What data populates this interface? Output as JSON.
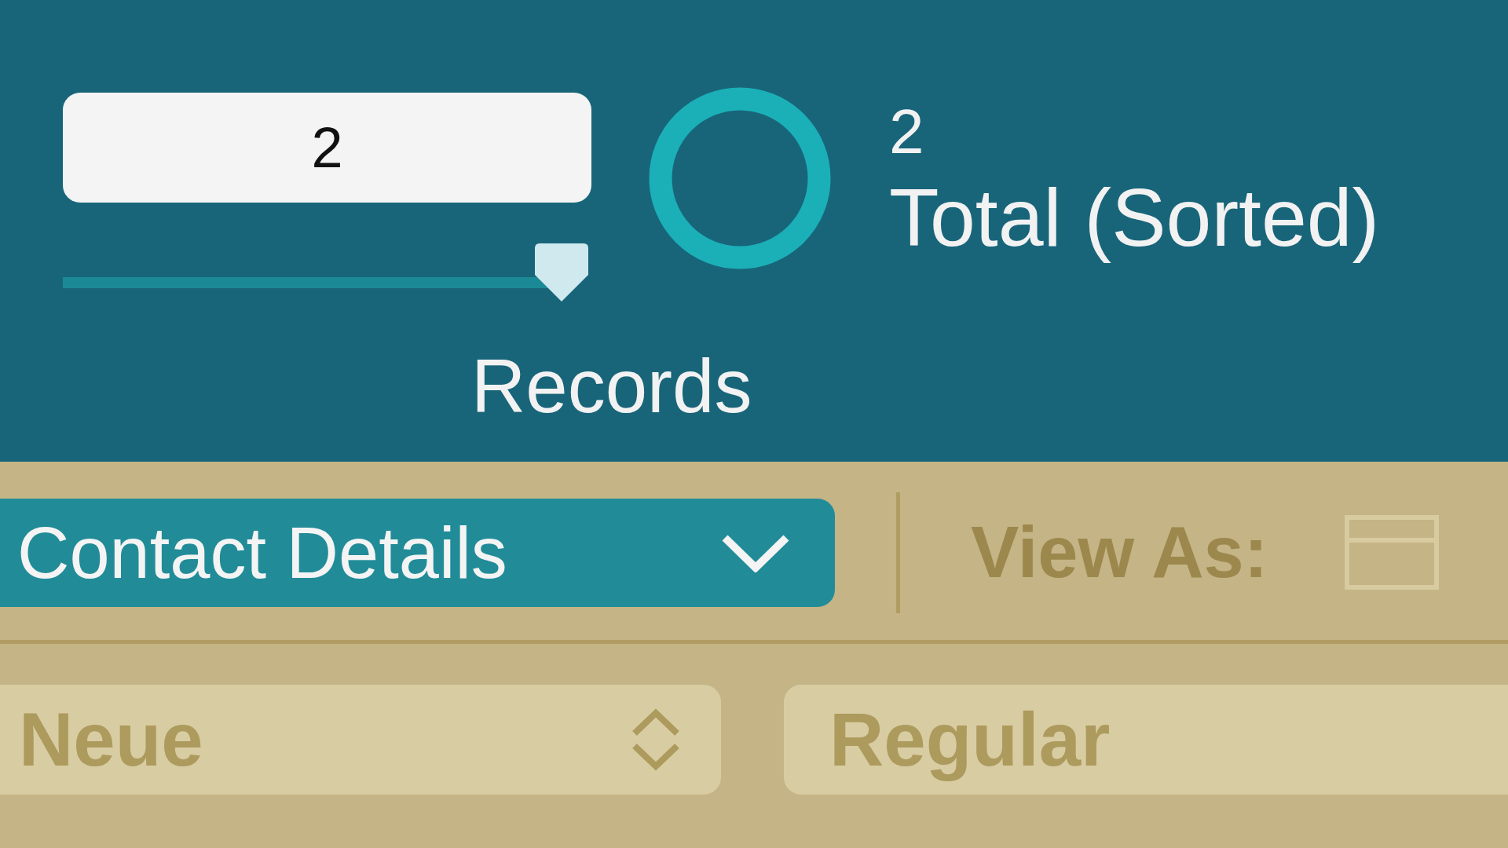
{
  "record_field": {
    "value": "2"
  },
  "record_slider": {
    "level": 1
  },
  "found_count": "2",
  "total_label": "Total (Sorted)",
  "records_label": "Records",
  "layout_menu": {
    "label": "Contact Details"
  },
  "view_as": {
    "label": "View As:"
  },
  "font_fields": [
    {
      "value": "Neue",
      "kind": "stepper"
    },
    {
      "value": "Regular",
      "kind": "plain"
    }
  ]
}
